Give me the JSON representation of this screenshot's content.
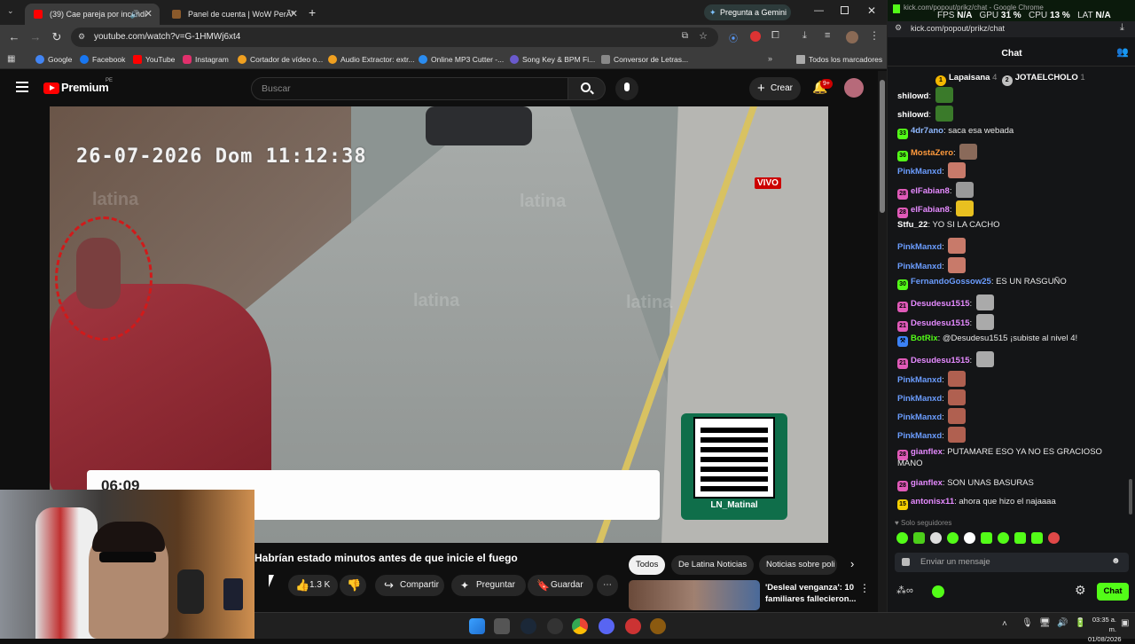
{
  "browser": {
    "tabs": [
      {
        "title": "(39) Cae pareja por incendi",
        "active": true
      },
      {
        "title": "Panel de cuenta | WoW PerÃº",
        "active": false
      }
    ],
    "gemini_label": "Pregunta a Gemini",
    "url": "youtube.com/watch?v=G-1HMWj6xt4",
    "bookmarks": [
      "Google",
      "Facebook",
      "YouTube",
      "Instagram",
      "Cortador de vídeo o...",
      "Audio Extractor: extr...",
      "Online MP3 Cutter -...",
      "Song Key & BPM Fi...",
      "Conversor de Letras..."
    ],
    "all_bookmarks": "Todos los marcadores"
  },
  "youtube": {
    "logo": "Premium",
    "logo_region": "PE",
    "search_placeholder": "Buscar",
    "create_label": "Crear",
    "notif_count": "9+",
    "video_overlay": {
      "timestamp": "26-07-2026 Dom 11:12:38",
      "live_label": "VIVO",
      "clock": "06:09",
      "watermark": "latina",
      "qr_handle": "LN_Matinal"
    },
    "video_title": "Habrían estado minutos antes de que inicie el fuego",
    "likes": "1.3 K",
    "share_label": "Compartir",
    "ask_label": "Preguntar",
    "save_label": "Guardar",
    "filter_chips": [
      "Todos",
      "De Latina Noticias",
      "Noticias sobre poli"
    ],
    "rec_title_1": "'Desleal venganza': 10",
    "rec_title_2": "familiares fallecieron..."
  },
  "kick": {
    "window_title": "kick.com/popout/prikz/chat - Google Chrome",
    "stats": {
      "fps_label": "FPS",
      "fps": "N/A",
      "gpu_label": "GPU",
      "gpu": "31 %",
      "cpu_label": "CPU",
      "cpu": "13 %",
      "lat_label": "LAT",
      "lat": "N/A"
    },
    "url": "kick.com/popout/prikz/chat",
    "header": "Chat",
    "leaders": [
      {
        "name": "Lapaisana",
        "count": "4"
      },
      {
        "name": "JOTAELCHOLO",
        "count": "1"
      }
    ],
    "messages": [
      {
        "user": "shilowd",
        "color": "#ffffff",
        "text": "",
        "badge": "",
        "emote": "#3a7a2a"
      },
      {
        "user": "shilowd",
        "color": "#ffffff",
        "text": "",
        "badge": "",
        "emote": "#3a7a2a"
      },
      {
        "user": "4dr7ano",
        "color": "#8fb8ff",
        "text": "saca esa webada",
        "badge": "33",
        "badgecolor": "#53fc18",
        "emote": ""
      },
      {
        "user": "MostaZero",
        "color": "#ff9a3c",
        "text": "",
        "badge": "36",
        "badgecolor": "#53fc18",
        "emote": "#8a6a5a"
      },
      {
        "user": "PinkManxd",
        "color": "#6b9dff",
        "text": "",
        "badge": "",
        "emote": "#c87a6a"
      },
      {
        "user": "elFabian8",
        "color": "#e58aff",
        "text": "",
        "badge": "28",
        "badgecolor": "#e05ab8",
        "emote": "#999"
      },
      {
        "user": "elFabian8",
        "color": "#e58aff",
        "text": "",
        "badge": "28",
        "badgecolor": "#e05ab8",
        "emote": "#e8c020"
      },
      {
        "user": "Stfu_22",
        "color": "#ffffff",
        "text": "YO SI LA CACHO",
        "badge": "",
        "emote": ""
      },
      {
        "user": "PinkManxd",
        "color": "#6b9dff",
        "text": "",
        "badge": "",
        "emote": "#c87a6a"
      },
      {
        "user": "PinkManxd",
        "color": "#6b9dff",
        "text": "",
        "badge": "",
        "emote": "#c87a6a"
      },
      {
        "user": "FernandoGossow25",
        "color": "#6b9dff",
        "text": "ES UN RASGUÑO",
        "badge": "30",
        "badgecolor": "#53fc18",
        "emote": ""
      },
      {
        "user": "Desudesu1515",
        "color": "#e58aff",
        "text": "",
        "badge": "21",
        "badgecolor": "#e05ab8",
        "emote": "#aaa"
      },
      {
        "user": "Desudesu1515",
        "color": "#e58aff",
        "text": "",
        "badge": "21",
        "badgecolor": "#e05ab8",
        "emote": "#aaa"
      },
      {
        "user": "BotRix",
        "color": "#53fc18",
        "text": "@Desudesu1515 ¡subiste al nivel 4!",
        "badge": "⚒",
        "badgecolor": "#3b82f6",
        "emote": ""
      },
      {
        "user": "Desudesu1515",
        "color": "#e58aff",
        "text": "",
        "badge": "21",
        "badgecolor": "#e05ab8",
        "emote": "#aaa"
      },
      {
        "user": "PinkManxd",
        "color": "#6b9dff",
        "text": "",
        "badge": "",
        "emote": "#b06050"
      },
      {
        "user": "PinkManxd",
        "color": "#6b9dff",
        "text": "",
        "badge": "",
        "emote": "#b06050"
      },
      {
        "user": "PinkManxd",
        "color": "#6b9dff",
        "text": "",
        "badge": "",
        "emote": "#b06050"
      },
      {
        "user": "PinkManxd",
        "color": "#6b9dff",
        "text": "",
        "badge": "",
        "emote": "#b06050"
      },
      {
        "user": "gianflex",
        "color": "#e58aff",
        "text": "PUTAMARE ESO YA NO ES GRACIOSO",
        "text2": "MANO",
        "badge": "28",
        "badgecolor": "#e05ab8",
        "emote": ""
      },
      {
        "user": "gianflex",
        "color": "#e58aff",
        "text": "SON UNAS BASURAS",
        "badge": "28",
        "badgecolor": "#e05ab8",
        "emote": ""
      },
      {
        "user": "antonisx11",
        "color": "#e58aff",
        "text": "ahora que hizo el najaaaa",
        "badge": "15",
        "badgecolor": "#f5d000",
        "emote": ""
      }
    ],
    "followers_only": "Solo seguidores",
    "input_placeholder": "Enviar un mensaje",
    "chat_button": "Chat"
  },
  "taskbar": {
    "time": "03:35 a. m.",
    "date": "01/08/2026"
  },
  "colors": {
    "kick_green": "#53fc18",
    "yt_red": "#ff0000"
  }
}
